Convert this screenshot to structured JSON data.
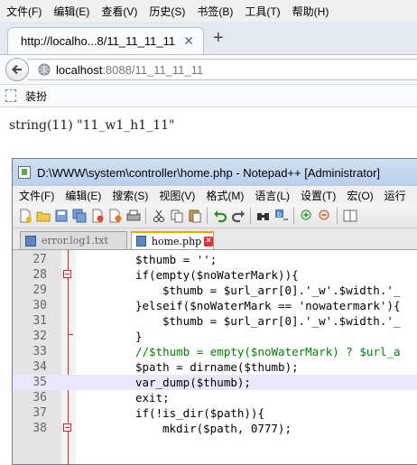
{
  "browser": {
    "menu": [
      "文件(F)",
      "编辑(E)",
      "查看(V)",
      "历史(S)",
      "书签(B)",
      "工具(T)",
      "帮助(H)"
    ],
    "tab_title": "http://localho...8/11_11_11_11",
    "url_host": "localhost",
    "url_path": ":8088/11_11_11_11",
    "bookmark": "装扮",
    "page_output": "string(11) \"11_w1_h1_11\""
  },
  "editor": {
    "window_title": "D:\\WWW\\system\\controller\\home.php - Notepad++ [Administrator]",
    "menu": [
      "文件(F)",
      "编辑(E)",
      "搜索(S)",
      "视图(V)",
      "格式(M)",
      "语言(L)",
      "设置(T)",
      "宏(O)",
      "运行"
    ],
    "tabs": [
      {
        "label": "error.log1.txt",
        "active": false
      },
      {
        "label": "home.php",
        "active": true
      }
    ],
    "line_numbers": [
      "27",
      "28",
      "29",
      "30",
      "31",
      "32",
      "33",
      "34",
      "35",
      "36",
      "37",
      "38"
    ],
    "lines": [
      "$thumb = '';",
      "if(empty($noWaterMark)){",
      "$thumb = $url_arr[0].'_w'.$width.'_",
      "}elseif($noWaterMark == 'nowatermark'){",
      "$thumb = $url_arr[0].'_w'.$width.'_",
      "}",
      "//$thumb = empty($noWaterMark) ? $url_a",
      "$path = dirname($thumb);",
      "var_dump($thumb);",
      "exit;",
      "if(!is_dir($path)){",
      "mkdir($path, 0777);"
    ]
  }
}
